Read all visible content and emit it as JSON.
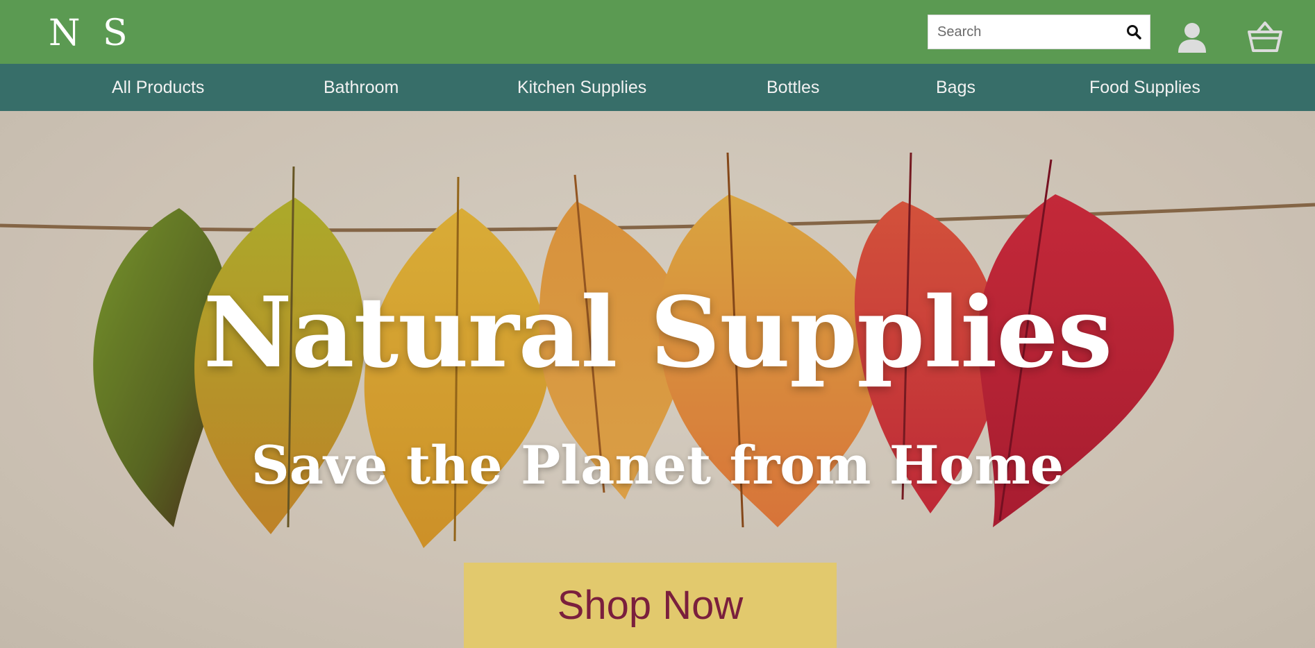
{
  "header": {
    "logo": "N S",
    "search": {
      "placeholder": "Search",
      "value": ""
    },
    "icons": [
      "search-icon",
      "user-icon",
      "cart-icon"
    ]
  },
  "nav": {
    "items": [
      {
        "label": "All Products"
      },
      {
        "label": "Bathroom"
      },
      {
        "label": "Kitchen Supplies"
      },
      {
        "label": "Bottles"
      },
      {
        "label": "Bags"
      },
      {
        "label": "Food Supplies"
      }
    ]
  },
  "hero": {
    "title": "Natural Supplies",
    "subtitle": "Save the Planet from Home",
    "cta_label": "Shop Now",
    "image": "autumn-leaves-on-string"
  },
  "colors": {
    "topbar": "#5b9a52",
    "navbar": "#376e69",
    "cta_background": "#e2c96d",
    "cta_text": "#7a1f3d"
  }
}
